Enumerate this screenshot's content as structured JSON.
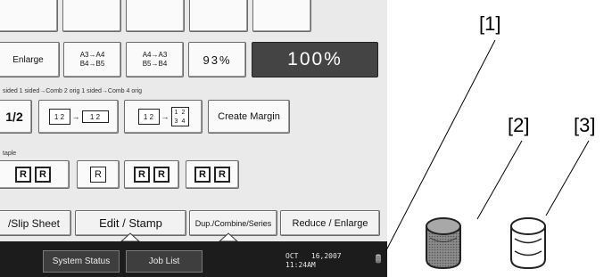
{
  "tabs_row1": [
    "",
    "",
    "",
    "",
    ""
  ],
  "ratio_row": {
    "enlarge_label": "Enlarge",
    "preset1": [
      "A3→A4",
      "B4→B5"
    ],
    "preset2": [
      "A4→A3",
      "B5→B4"
    ],
    "percent_93": "93%",
    "percent_100": "100%"
  },
  "combine_section": {
    "label": "sided   1 sided→Comb 2 orig  1 sided→Comb 4 orig",
    "partial_icon": "1/2",
    "comb2_pages": [
      "1",
      "2"
    ],
    "comb2_result": [
      "1",
      "2"
    ],
    "comb4_pages": [
      "1",
      "2"
    ],
    "comb4_result": [
      "1",
      "2",
      "3",
      "4"
    ],
    "create_margin": "Create Margin"
  },
  "staple_section": {
    "label": "taple",
    "mark": "R"
  },
  "bottom_tabs": {
    "slip_sheet": "/Slip Sheet",
    "edit_stamp": "Edit / Stamp",
    "dup_combine": "Dup./Combine/Series",
    "reduce_enlarge": "Reduce / Enlarge"
  },
  "status_bar": {
    "system_status": "System Status",
    "job_list": "Job List",
    "date": "OCT   16,2007",
    "time": "11:24AM"
  },
  "callouts": {
    "c1": "[1]",
    "c2": "[2]",
    "c3": "[3]"
  },
  "indicator_icons": [
    "data-in-indicator-lit",
    "data-in-indicator-off"
  ]
}
